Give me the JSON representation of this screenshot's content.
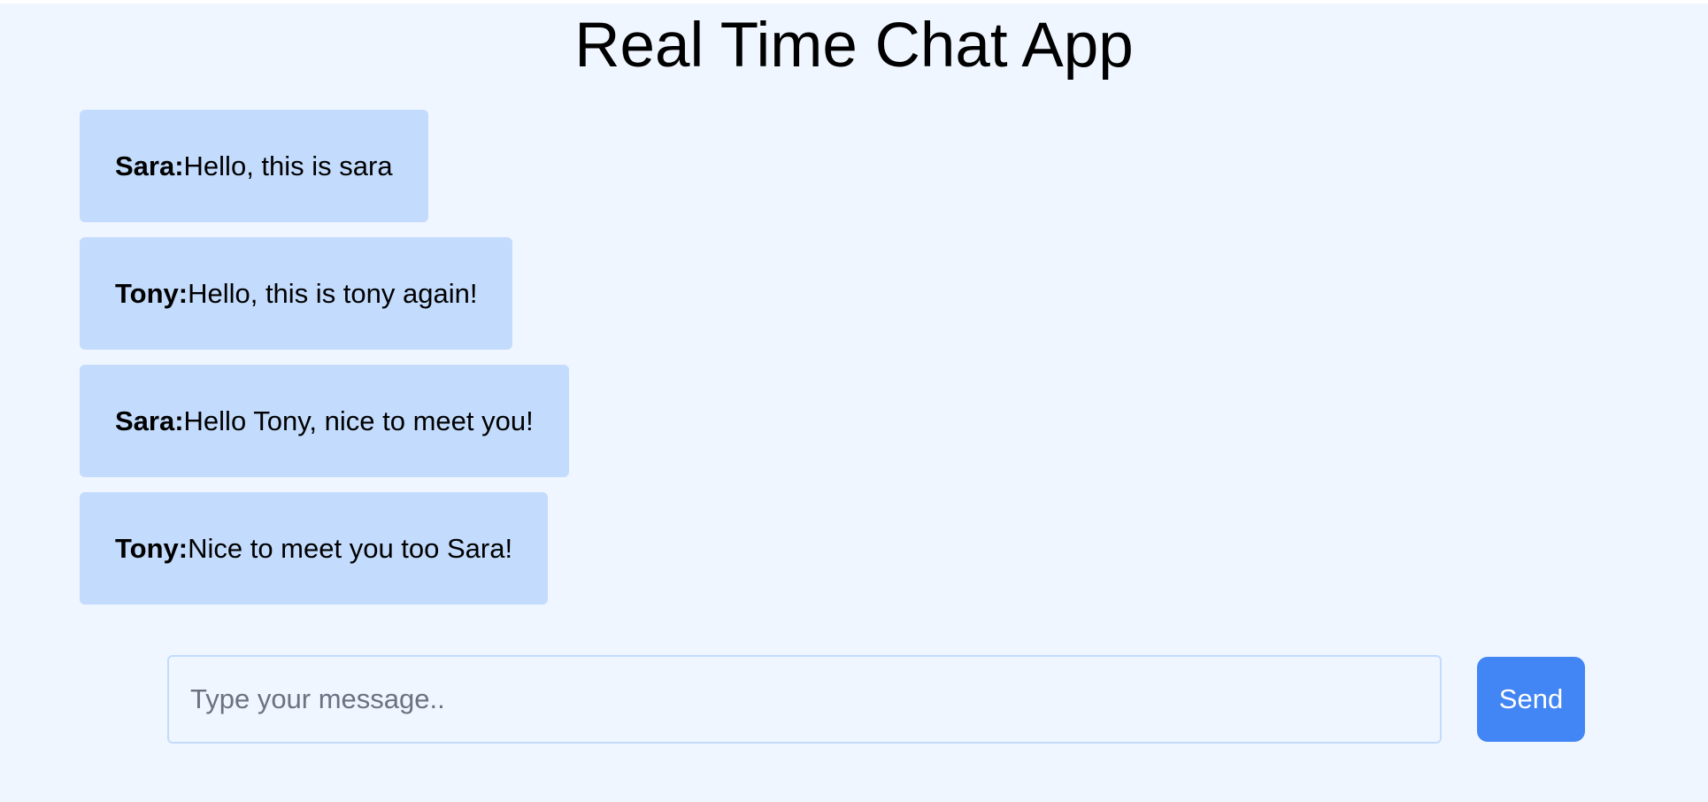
{
  "app": {
    "title": "Real Time Chat App"
  },
  "messages": [
    {
      "sender": "Sara:",
      "text": "Hello, this is sara"
    },
    {
      "sender": "Tony:",
      "text": "Hello, this is tony again!"
    },
    {
      "sender": "Sara:",
      "text": "Hello Tony, nice to meet you!"
    },
    {
      "sender": "Tony:",
      "text": "Nice to meet you too Sara!"
    }
  ],
  "composer": {
    "value": "",
    "placeholder": "Type your message..",
    "send_label": "Send"
  },
  "colors": {
    "page_background": "#eff6ff",
    "message_background": "#c3dbfc",
    "accent": "#4285f4"
  }
}
